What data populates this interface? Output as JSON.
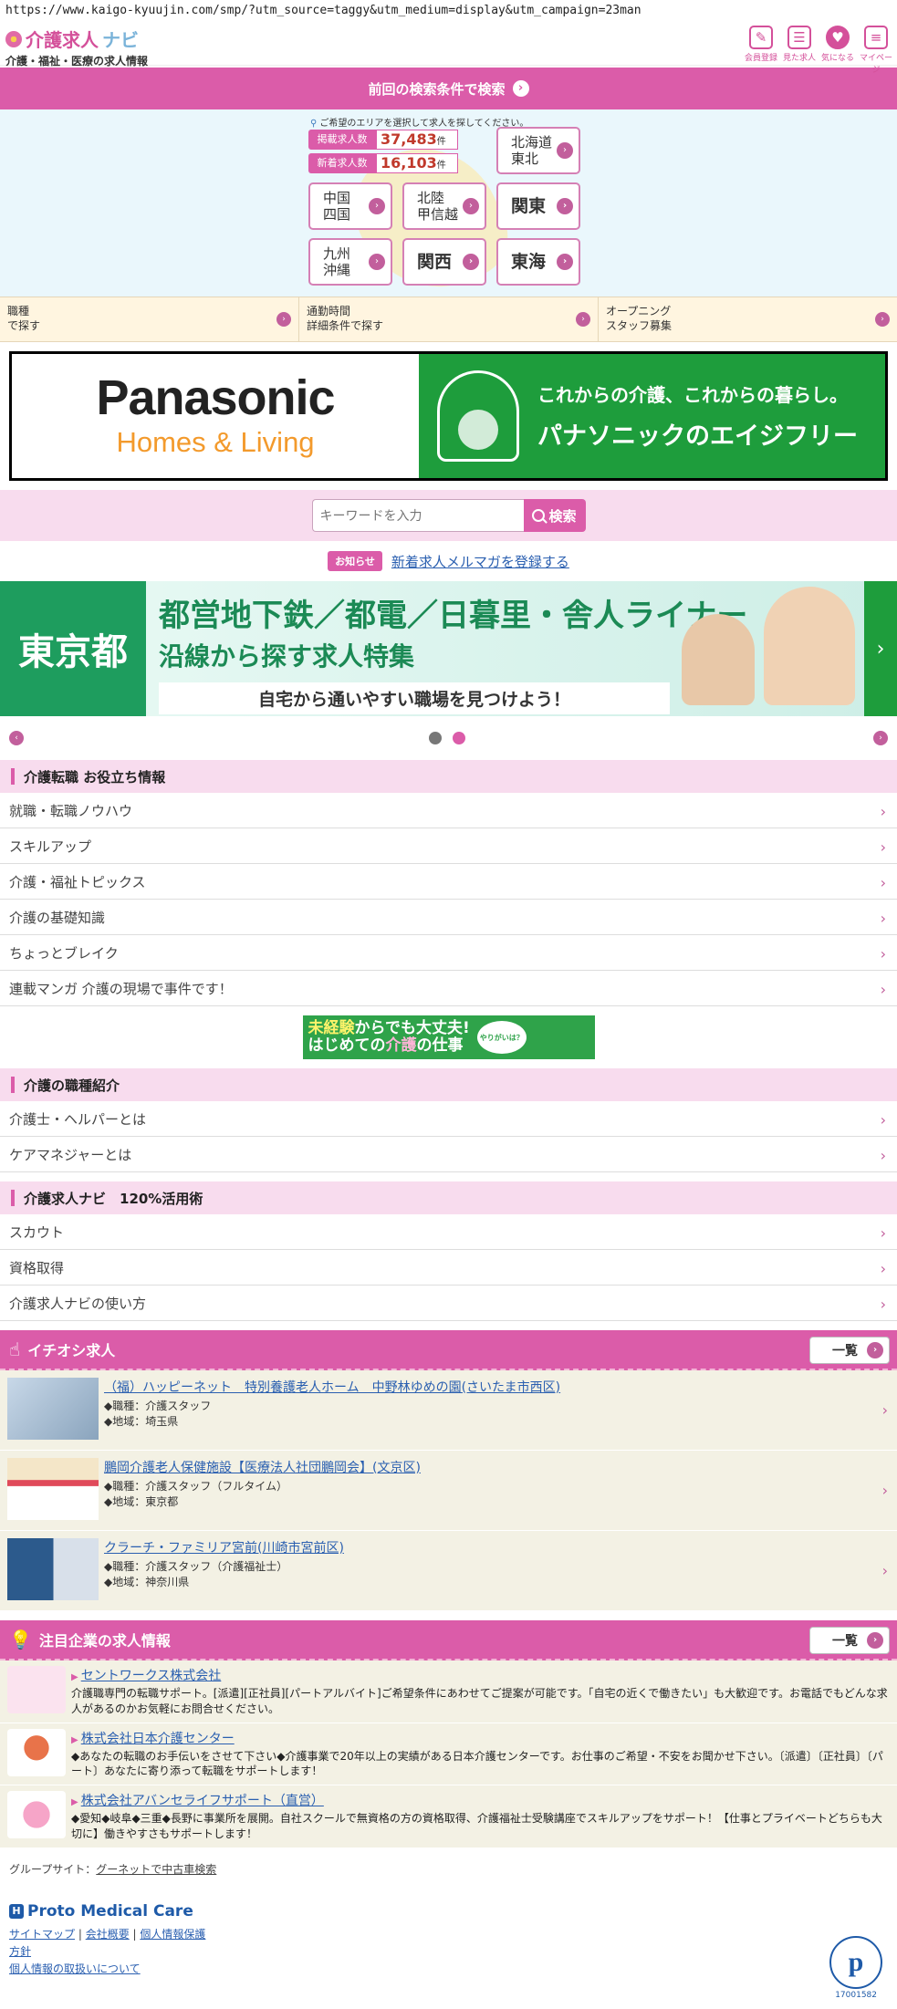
{
  "url": "https://www.kaigo-kyuujin.com/smp/?utm_source=taggy&utm_medium=display&utm_campaign=23man",
  "header": {
    "logo_main": "介護求人",
    "logo_nav": "ナビ",
    "logo_sub": "介護・福祉・医療の求人情報",
    "icons": [
      {
        "label": "会員登録",
        "icon": "pencil-icon"
      },
      {
        "label": "見た求人",
        "icon": "history-icon"
      },
      {
        "label": "気になる",
        "icon": "heart-icon"
      },
      {
        "label": "マイページ",
        "icon": "mypage-icon"
      }
    ]
  },
  "prev_search": "前回の検索条件で検索",
  "area": {
    "hint": "ご希望のエリアを選択して求人を探してください。",
    "listed_label": "掲載求人数",
    "listed_count": "37,483",
    "new_label": "新着求人数",
    "new_count": "16,103",
    "unit": "件",
    "buttons": {
      "hokkaido_l1": "北海道",
      "hokkaido_l2": "東北",
      "chugoku_l1": "中国",
      "chugoku_l2": "四国",
      "hokuriku_l1": "北陸",
      "hokuriku_l2": "甲信越",
      "kanto": "関東",
      "kyushu_l1": "九州",
      "kyushu_l2": "沖縄",
      "kansai": "関西",
      "tokai": "東海"
    }
  },
  "quick_links": {
    "job_l1": "職種",
    "job_l2": "で探す",
    "commute_l1": "通勤時間",
    "commute_l2": "詳細条件で探す",
    "opening_l1": "オープニング",
    "opening_l2": "スタッフ募集"
  },
  "ad_banner": {
    "brand": "Panasonic",
    "brand_sub": "Homes & Living",
    "tagline": "これからの介護、これからの暮らし。",
    "title": "パナソニックのエイジフリー"
  },
  "search": {
    "placeholder": "キーワードを入力",
    "button": "検索"
  },
  "notice": {
    "badge": "お知らせ",
    "link": "新着求人メルマガを登録する"
  },
  "tokyo_banner": {
    "left": "東京都",
    "line1": "都営地下鉄／都電／日暮里・舎人ライナー",
    "line2": "沿線から探す求人特集",
    "line3": "自宅から通いやすい職場を見つけよう！"
  },
  "sections": {
    "tips_title": "介護転職 お役立ち情報",
    "tips": [
      "就職・転職ノウハウ",
      "スキルアップ",
      "介護・福祉トピックス",
      "介護の基礎知識",
      "ちょっとブレイク",
      "連載マンガ 介護の現場で事件です！"
    ],
    "beginner_l1a": "未経験",
    "beginner_l1b": "からでも大丈夫!",
    "beginner_l2a": "はじめての",
    "beginner_l2b": "介護",
    "beginner_l2c": "の仕事",
    "beginner_bubble": "やりがいは？",
    "jobtypes_title": "介護の職種紹介",
    "jobtypes": [
      "介護士・ヘルパーとは",
      "ケアマネジャーとは"
    ],
    "use_title": "介護求人ナビ　120%活用術",
    "use": [
      "スカウト",
      "資格取得",
      "介護求人ナビの使い方"
    ]
  },
  "pickup": {
    "title": "イチオシ求人",
    "more": "一覧",
    "jobs": [
      {
        "title": "（福）ハッピーネット　特別養護老人ホーム　中野林ゆめの園(さいたま市西区)",
        "type": "◆職種：介護スタッフ",
        "area": "◆地域：埼玉県"
      },
      {
        "title": "鵬岡介護老人保健施設【医療法人社団鵬岡会】(文京区)",
        "type": "◆職種：介護スタッフ（フルタイム）",
        "area": "◆地域：東京都"
      },
      {
        "title": "クラーチ・ファミリア宮前(川崎市宮前区)",
        "type": "◆職種：介護スタッフ（介護福祉士）",
        "area": "◆地域：神奈川県"
      }
    ]
  },
  "companies": {
    "title": "注目企業の求人情報",
    "more": "一覧",
    "items": [
      {
        "name": "セントワークス株式会社",
        "desc": "介護職専門の転職サポート。[派遣][正社員][パートアルバイト]ご希望条件にあわせてご提案が可能です。「自宅の近くで働きたい」も大歓迎です。お電話でもどんな求人があるのかお気軽にお問合せください。"
      },
      {
        "name": "株式会社日本介護センター",
        "desc": "◆あなたの転職のお手伝いをさせて下さい◆介護事業で20年以上の実績がある日本介護センターです。お仕事のご希望・不安をお聞かせ下さい。〔派遣〕〔正社員〕〔パート〕あなたに寄り添って転職をサポートします！"
      },
      {
        "name": "株式会社アバンセライフサポート（直営）",
        "desc": "◆愛知◆岐阜◆三重◆長野に事業所を展開。自社スクールで無資格の方の資格取得、介護福祉士受験講座でスキルアップをサポート！【仕事とプライベートどちらも大切に】働きやすさもサポートします！"
      }
    ]
  },
  "footer": {
    "group_label": "グループサイト：",
    "group_link": "グーネットで中古車検索",
    "brand": "Proto Medical Care",
    "links": [
      "サイトマップ",
      "会社概要",
      "個人情報保護",
      "方針",
      "個人情報の取扱いについて"
    ],
    "pmark_number": "17001582"
  }
}
